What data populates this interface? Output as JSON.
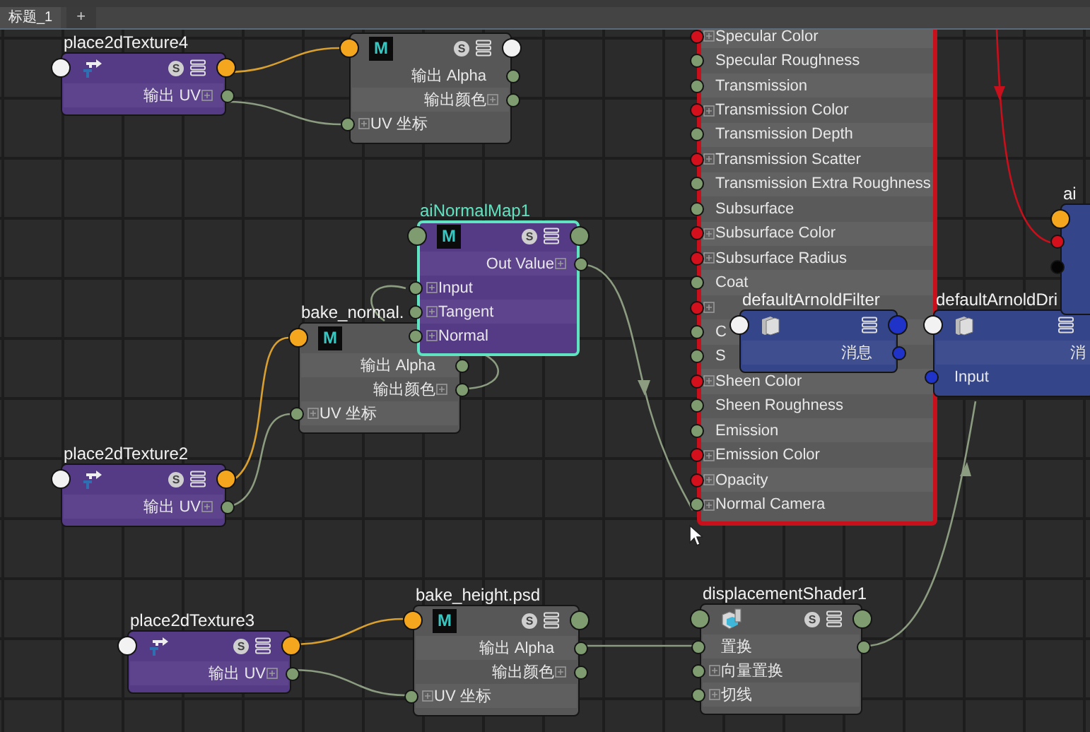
{
  "tabs": [
    {
      "label": "标题_1",
      "selected": true
    }
  ],
  "new_tab_button": "+",
  "nodes": [
    {
      "kind": "place2d",
      "title": "place2dTexture4",
      "selected": false,
      "badge": "S",
      "in_port": {
        "color": "#f2f2f2"
      },
      "out_port": {
        "color": "#f4a61e"
      },
      "rows": [
        {
          "label": "输出 UV",
          "kind": "out",
          "color": "#7f9c70",
          "expandable": true
        }
      ]
    },
    {
      "kind": "file",
      "letter": "M",
      "badge": "S",
      "selected": false,
      "in_port": {
        "color": "#f4a61e"
      },
      "out_port": {
        "color": "#f2f2f2"
      },
      "rows": [
        {
          "label": "输出 Alpha",
          "kind": "out",
          "color": "#7f9c70",
          "expandable": false
        },
        {
          "label": "输出颜色",
          "kind": "out",
          "color": "#7f9c70",
          "expandable": true
        },
        {
          "label": "UV 坐标",
          "kind": "in",
          "color": "#7f9c70",
          "expandable": true
        }
      ]
    },
    {
      "kind": "file",
      "title": "bake_normal.",
      "letter": "M",
      "selected": false,
      "in_port": {
        "color": "#f4a61e"
      },
      "rows": [
        {
          "label": "输出 Alpha",
          "kind": "out",
          "color": "#7f9c70",
          "expandable": false
        },
        {
          "label": "输出颜色",
          "kind": "out",
          "color": "#7f9c70",
          "expandable": true
        },
        {
          "label": "UV 坐标",
          "kind": "in",
          "color": "#7f9c70",
          "expandable": true
        }
      ]
    },
    {
      "kind": "normal_map",
      "title": "aiNormalMap1",
      "letter": "M",
      "badge": "S",
      "selected": true,
      "in_port": {
        "color": "#7f9c70"
      },
      "out_port": {
        "color": "#7f9c70"
      },
      "rows": [
        {
          "label": "Out Value",
          "kind": "out",
          "color": "#7f9c70",
          "expandable": true
        },
        {
          "label": "Input",
          "kind": "in",
          "color": "#7f9c70",
          "expandable": true
        },
        {
          "label": "Tangent",
          "kind": "in",
          "color": "#7f9c70",
          "expandable": true
        },
        {
          "label": "Normal",
          "kind": "in",
          "color": "#7f9c70",
          "expandable": true
        }
      ]
    },
    {
      "kind": "place2d",
      "title": "place2dTexture2",
      "selected": false,
      "badge": "S",
      "in_port": {
        "color": "#f2f2f2"
      },
      "out_port": {
        "color": "#f4a61e"
      },
      "rows": [
        {
          "label": "输出 UV",
          "kind": "out",
          "color": "#7f9c70",
          "expandable": true
        }
      ]
    },
    {
      "kind": "place2d",
      "title": "place2dTexture3",
      "selected": false,
      "badge": "S",
      "in_port": {
        "color": "#f2f2f2"
      },
      "out_port": {
        "color": "#f4a61e"
      },
      "rows": [
        {
          "label": "输出 UV",
          "kind": "out",
          "color": "#7f9c70",
          "expandable": true
        }
      ]
    },
    {
      "kind": "file",
      "title": "bake_height.psd",
      "letter": "M",
      "badge": "S",
      "selected": false,
      "in_port": {
        "color": "#f4a61e"
      },
      "out_port": {
        "color": "#7f9c70"
      },
      "rows": [
        {
          "label": "输出 Alpha",
          "kind": "out",
          "color": "#7f9c70",
          "expandable": false
        },
        {
          "label": "输出颜色",
          "kind": "out",
          "color": "#7f9c70",
          "expandable": true
        },
        {
          "label": "UV 坐标",
          "kind": "in",
          "color": "#7f9c70",
          "expandable": true
        }
      ]
    },
    {
      "kind": "surface",
      "selected": false,
      "rows": [
        {
          "label": "Specular Color",
          "kind": "in",
          "color": "#d3101c",
          "expandable": true
        },
        {
          "label": "Specular Roughness",
          "kind": "in",
          "color": "#7f9c70",
          "expandable": false
        },
        {
          "label": "Transmission",
          "kind": "in",
          "color": "#7f9c70",
          "expandable": false
        },
        {
          "label": "Transmission Color",
          "kind": "in",
          "color": "#d3101c",
          "expandable": true
        },
        {
          "label": "Transmission Depth",
          "kind": "in",
          "color": "#7f9c70",
          "expandable": false
        },
        {
          "label": "Transmission Scatter",
          "kind": "in",
          "color": "#d3101c",
          "expandable": true
        },
        {
          "label": "Transmission Extra Roughness",
          "kind": "in",
          "color": "#7f9c70",
          "expandable": false
        },
        {
          "label": "Subsurface",
          "kind": "in",
          "color": "#7f9c70",
          "expandable": false
        },
        {
          "label": "Subsurface Color",
          "kind": "in",
          "color": "#d3101c",
          "expandable": true
        },
        {
          "label": "Subsurface Radius",
          "kind": "in",
          "color": "#d3101c",
          "expandable": true
        },
        {
          "label": "Coat",
          "kind": "in",
          "color": "#7f9c70",
          "expandable": false
        },
        {
          "kind": "in",
          "color": "#d3101c",
          "expandable": true
        },
        {
          "label": "C",
          "kind": "in",
          "color": "#7f9c70",
          "expandable": false
        },
        {
          "label": "S",
          "kind": "in",
          "color": "#7f9c70",
          "expandable": false
        },
        {
          "label": "Sheen Color",
          "kind": "in",
          "color": "#d3101c",
          "expandable": true
        },
        {
          "label": "Sheen Roughness",
          "kind": "in",
          "color": "#7f9c70",
          "expandable": false
        },
        {
          "label": "Emission",
          "kind": "in",
          "color": "#7f9c70",
          "expandable": false
        },
        {
          "label": "Emission Color",
          "kind": "in",
          "color": "#d3101c",
          "expandable": true
        },
        {
          "label": "Opacity",
          "kind": "in",
          "color": "#d3101c",
          "expandable": true
        },
        {
          "label": "Normal Camera",
          "kind": "in",
          "color": "#7f9c70",
          "expandable": true
        }
      ]
    },
    {
      "kind": "filter",
      "title": "defaultArnoldFilter",
      "selected": false,
      "in_port": {
        "color": "#f2f2f2"
      },
      "out_port": {
        "color": "#1f33c8"
      },
      "rows": [
        {
          "label": "消息",
          "kind": "out",
          "color": "#1f33c8",
          "expandable": false
        }
      ]
    },
    {
      "kind": "driver",
      "title": "defaultArnoldDri",
      "selected": false,
      "in_port": {
        "color": "#f2f2f2"
      },
      "rows": [
        {
          "label": "消",
          "kind": "none",
          "expandable": false
        },
        {
          "label": "Input",
          "kind": "in",
          "color": "#1f33c8",
          "expandable": false
        }
      ]
    },
    {
      "kind": "partial",
      "title": "ai",
      "selected": false,
      "ports": [
        {
          "color": "#f4a61e"
        },
        {
          "color": "#d3101c"
        },
        {
          "color": "#050505"
        }
      ]
    },
    {
      "kind": "displacement",
      "title": "displacementShader1",
      "badge": "S",
      "selected": false,
      "in_port": {
        "color": "#7f9c70"
      },
      "out_port": {
        "color": "#7f9c70"
      },
      "rows": [
        {
          "label": "置换",
          "kind": "both",
          "color": "#7f9c70",
          "expandable": false
        },
        {
          "label": "向量置换",
          "kind": "in",
          "color": "#7f9c70",
          "expandable": true
        },
        {
          "label": "切线",
          "kind": "in",
          "color": "#7f9c70",
          "expandable": true
        }
      ]
    }
  ]
}
